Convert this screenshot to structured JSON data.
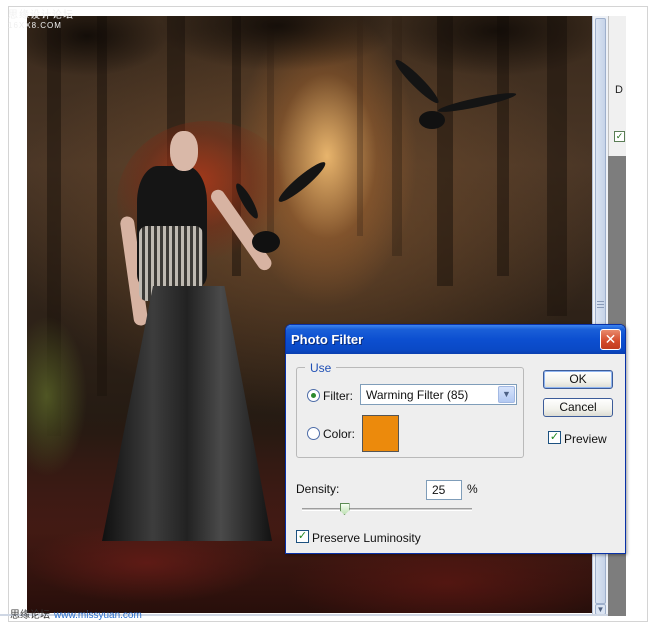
{
  "watermarks": {
    "top_line1": "思缘设计论坛",
    "top_line2": "16XX8.COM",
    "bottom_text": "思缘论坛",
    "bottom_url": "www.missyuan.com"
  },
  "side_panel": {
    "letter": "D",
    "check_glyph": "✓"
  },
  "scrollbar": {
    "down_arrow": "▼"
  },
  "dialog": {
    "title": "Photo Filter",
    "close_glyph": "✕",
    "use_group": {
      "legend": "Use",
      "filter_label": "Filter:",
      "filter_selected": "Warming Filter (85)",
      "filter_checked": true,
      "color_label": "Color:",
      "color_checked": false,
      "color_swatch": "#ec8a0c",
      "dropdown_glyph": "▼"
    },
    "ok_label": "OK",
    "cancel_label": "Cancel",
    "preview_label": "Preview",
    "preview_checked": true,
    "density_label": "Density:",
    "density_value": "25",
    "density_unit": "%",
    "density_fraction": 0.25,
    "preserve_luminosity_label": "Preserve Luminosity",
    "preserve_luminosity_checked": true,
    "check_glyph": "✓"
  }
}
